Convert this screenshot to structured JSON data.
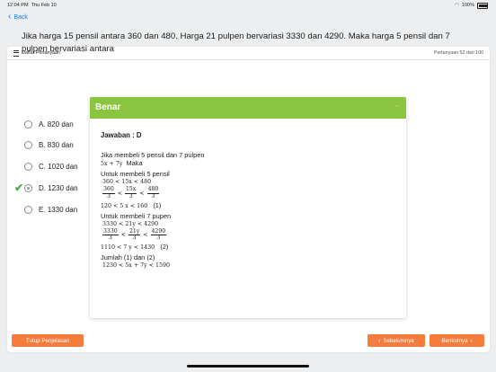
{
  "status_bar": {
    "time": "12:04 PM",
    "date": "Thu Feb 10",
    "battery": "100%"
  },
  "nav": {
    "back_label": "Back"
  },
  "header": {
    "list_label": "Daftar Pertanyaan",
    "question_counter": "Pertanyaan 52 dari 100"
  },
  "question": {
    "text": "Jika harga 15 pensil antara 360 dan 480. Harga 21 pulpen bervariasi 3330 dan 4290. Maka harga 5 pensil dan 7 pulpen bervariasi antara"
  },
  "options": [
    {
      "label": "A. 820 dan",
      "selected": false
    },
    {
      "label": "B. 830 dan",
      "selected": false
    },
    {
      "label": "C. 1020 dan",
      "selected": false
    },
    {
      "label": "D. 1230 dan",
      "selected": true
    },
    {
      "label": "E. 1330 dan",
      "selected": false
    }
  ],
  "explanation": {
    "title": "Benar",
    "answer": "Jawaban : D",
    "intro": "Jika membeli 5 pensil dan 7 pulpen",
    "expr_5x7y": "5x + 7y",
    "maka": "Maka",
    "pensil_heading": "Untuk membeli 5 pensil",
    "ineq_15x": "360 < 15x < 480",
    "frac_pensil": {
      "a_num": "360",
      "a_den": "3",
      "mid_num": "15x",
      "mid_den": "3",
      "b_num": "480",
      "b_den": "3"
    },
    "ineq_5x": "120 < 5 x < 160",
    "label_1": "(1)",
    "pulpen_heading": "Untuk membeli 7 pupen",
    "ineq_21y": "3330 < 21y < 4290",
    "frac_pulpen": {
      "a_num": "3330",
      "a_den": "3",
      "mid_num": "21y",
      "mid_den": "3",
      "b_num": "4290",
      "b_den": "3"
    },
    "ineq_7y": "1110 < 7 y < 1430",
    "label_2": "(2)",
    "sum_heading": "Jumlah (1) dan (2)",
    "ineq_sum": "1230 < 5x + 7y < 1590"
  },
  "footer": {
    "close_explanation": "Tutup Penjelasan",
    "previous": "Sebelumnya",
    "next": "Berikutnya"
  },
  "colors": {
    "accent_green": "#8bc43e",
    "button_orange": "#f47c3c",
    "link_blue": "#1c7ed6",
    "check_green": "#4caf50"
  }
}
